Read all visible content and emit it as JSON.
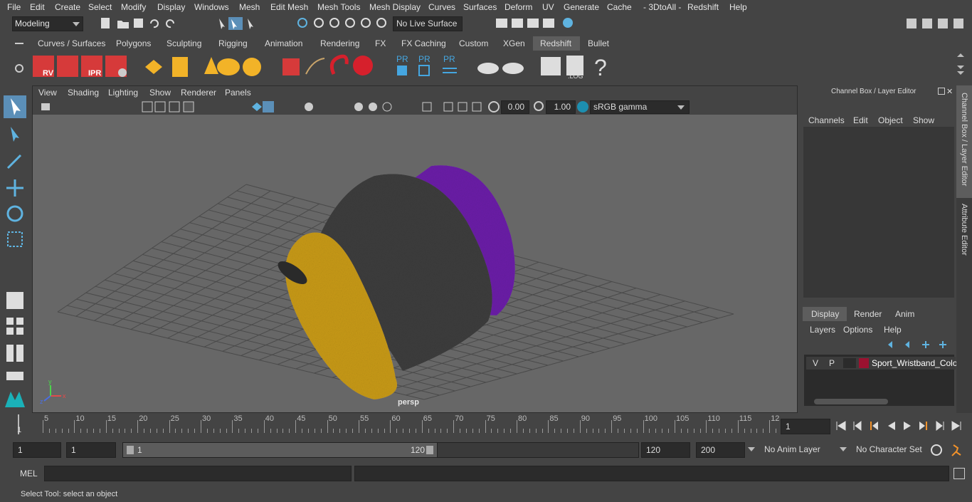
{
  "menus": [
    "File",
    "Edit",
    "Create",
    "Select",
    "Modify",
    "Display",
    "Windows",
    "Mesh",
    "Edit Mesh",
    "Mesh Tools",
    "Mesh Display",
    "Curves",
    "Surfaces",
    "Deform",
    "UV",
    "Generate",
    "Cache",
    "- 3DtoAll -",
    "Redshift",
    "Help"
  ],
  "status": {
    "mode": "Modeling",
    "live_surface": "No Live Surface"
  },
  "shelf_tabs": [
    "Curves / Surfaces",
    "Polygons",
    "Sculpting",
    "Rigging",
    "Animation",
    "Rendering",
    "FX",
    "FX Caching",
    "Custom",
    "XGen",
    "Redshift",
    "Bullet"
  ],
  "shelf_active": "Redshift",
  "shelf_icons": [
    "rs-rv-icon",
    "rs-render-icon",
    "rs-ipr-icon",
    "rs-settings-icon",
    "rs-lights-icon",
    "rs-grid-icon",
    "rs-cone-icon",
    "rs-dome-icon",
    "rs-sun-icon",
    "rs-cube-icon",
    "rs-hair-icon",
    "rs-snake-icon",
    "rs-sphere-icon",
    "rs-pr-icon",
    "rs-pr-export-icon",
    "rs-pr-sync-icon",
    "rs-proxy-icon",
    "rs-pie-icon",
    "rs-shader-icon",
    "rs-log-icon",
    "rs-help-icon"
  ],
  "shelf_labels": {
    "pr": "PR",
    "log": ".LOG",
    "rv": "RV",
    "ipr": "IPR",
    "help": "?"
  },
  "viewport": {
    "menus": [
      "View",
      "Shading",
      "Lighting",
      "Show",
      "Renderer",
      "Panels"
    ],
    "exposure": "0.00",
    "gamma_value": "1.00",
    "color_space": "sRGB gamma",
    "camera": "persp",
    "axis_x": "x",
    "axis_y": "y",
    "axis_z": "z"
  },
  "channel_box": {
    "title": "Channel Box / Layer Editor",
    "menus": [
      "Channels",
      "Edit",
      "Object",
      "Show"
    ],
    "layer_tabs": [
      "Display",
      "Render",
      "Anim"
    ],
    "layer_active": "Display",
    "layer_menus": [
      "Layers",
      "Options",
      "Help"
    ],
    "layer": {
      "v": "V",
      "p": "P",
      "name": "Sport_Wristband_Colo",
      "color": "#9b1230"
    }
  },
  "side_tabs": [
    "Channel Box / Layer Editor",
    "Attribute Editor"
  ],
  "timeline": {
    "ticks": [
      "5",
      "10",
      "15",
      "20",
      "25",
      "30",
      "35",
      "40",
      "45",
      "50",
      "55",
      "60",
      "65",
      "70",
      "75",
      "80",
      "85",
      "90",
      "95",
      "100",
      "105",
      "110",
      "115",
      "12"
    ],
    "current_label": "1",
    "current_frame": "1"
  },
  "range": {
    "start": "1",
    "anim_start": "1",
    "range_start": "1",
    "range_end": "120",
    "end": "120",
    "anim_end": "200",
    "anim_layer": "No Anim Layer",
    "char_set": "No Character Set"
  },
  "command_line": {
    "label": "MEL"
  },
  "help_line": "Select Tool: select an object",
  "colors": {
    "yellow": "#c89a14",
    "gray": "#3d3d3d",
    "purple": "#6b1fa8",
    "accent": "#4aa3d8"
  }
}
